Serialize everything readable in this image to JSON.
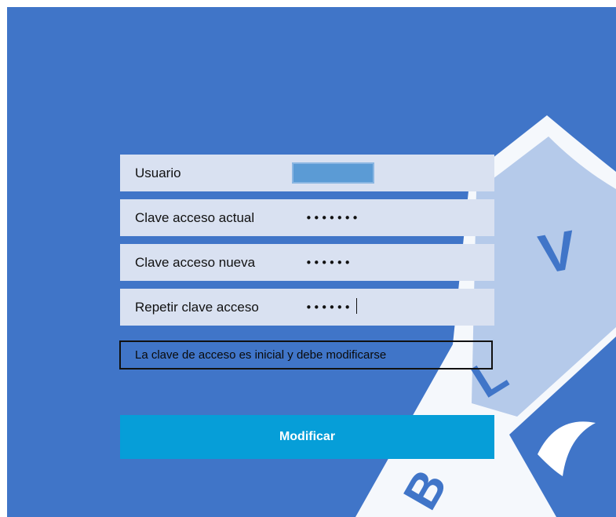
{
  "form": {
    "user": {
      "label": "Usuario",
      "value": ""
    },
    "current_password": {
      "label": "Clave acceso actual",
      "value": "•••••••"
    },
    "new_password": {
      "label": "Clave acceso nueva",
      "value": "••••••"
    },
    "repeat_password": {
      "label": "Repetir clave acceso",
      "value": "••••••"
    },
    "message": "La clave de acceso es inicial y debe modificarse",
    "submit_label": "Modificar"
  },
  "emblem": {
    "letters": [
      "V",
      "L",
      "B"
    ]
  },
  "colors": {
    "background": "#4075c8",
    "field_row": "#d9e1f1",
    "user_field": "#5b9bd5",
    "button": "#069ed8"
  }
}
